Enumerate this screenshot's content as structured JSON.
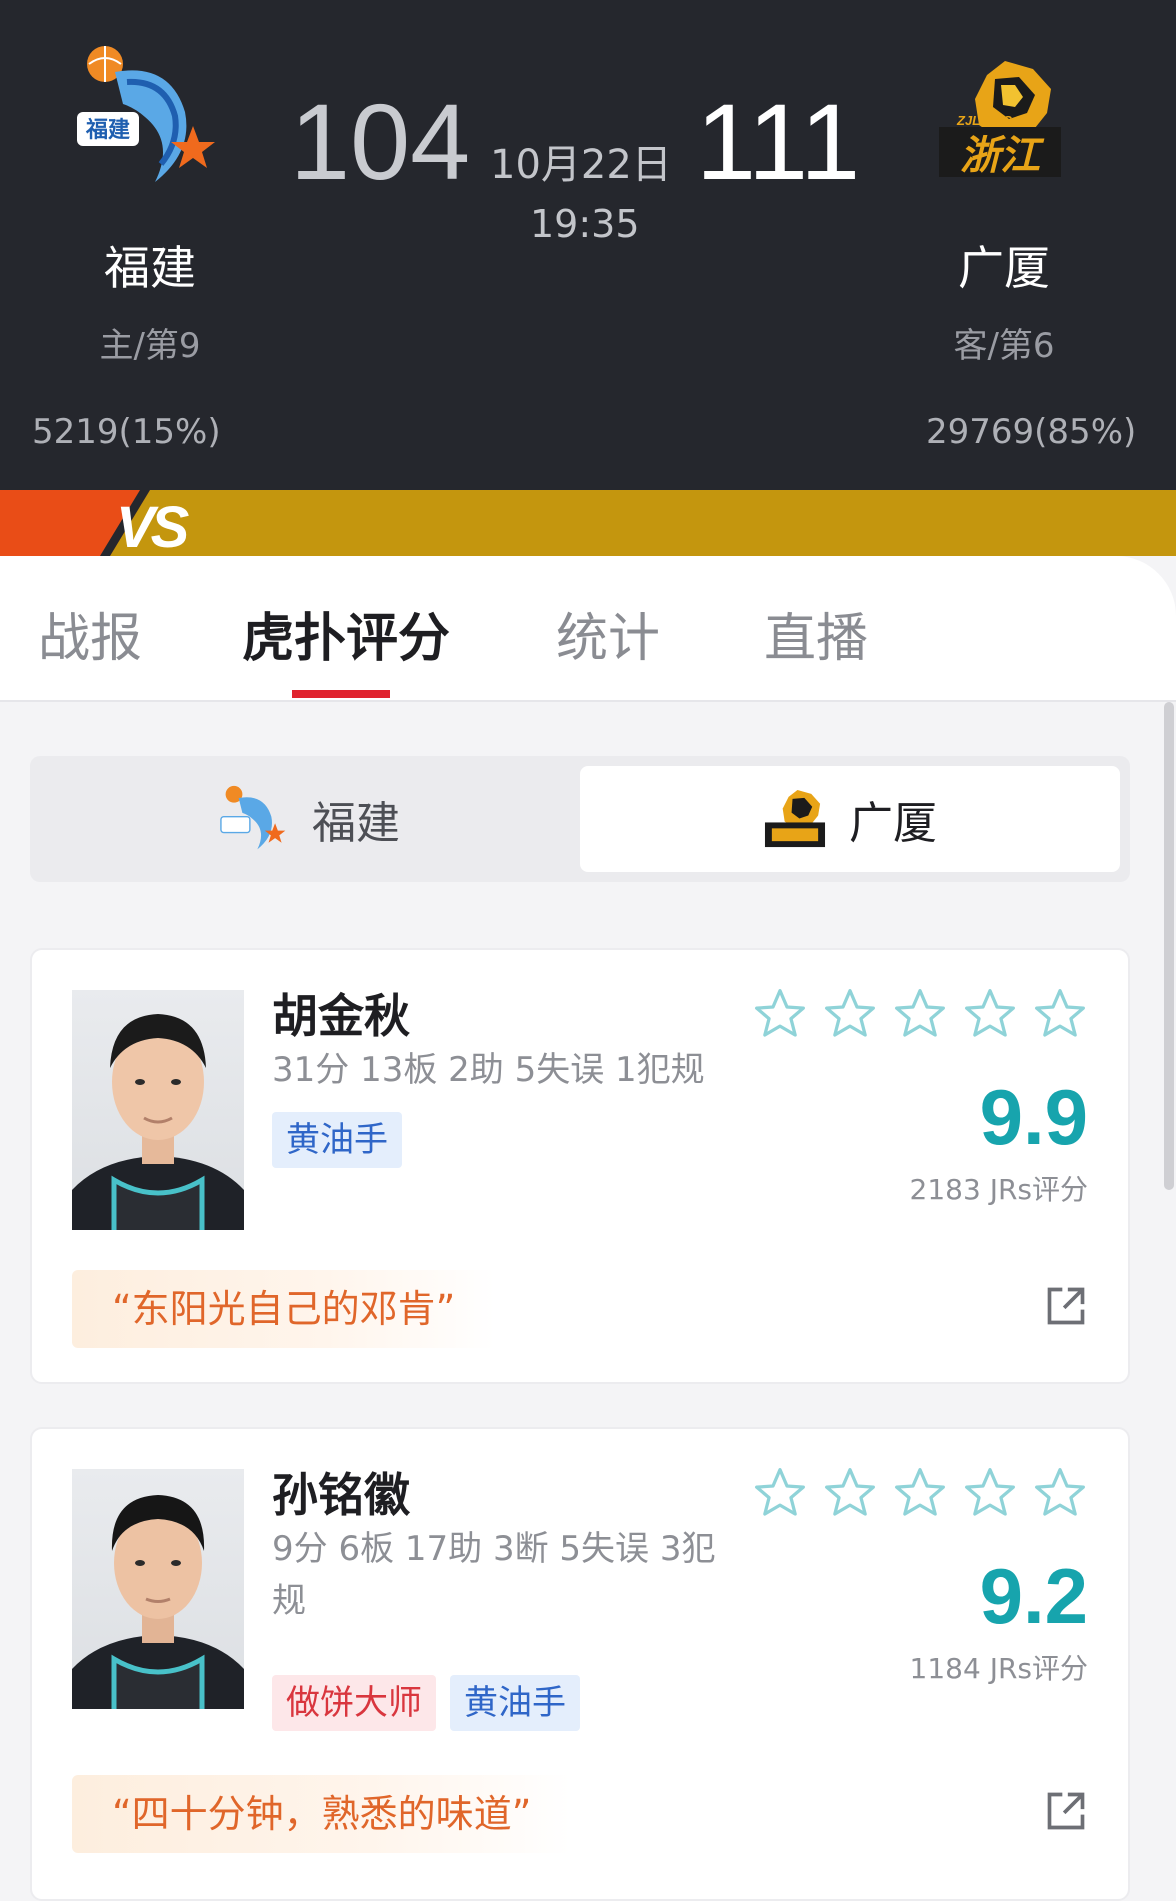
{
  "game": {
    "date": "10月22日",
    "time": "19:35",
    "vs_label": "VS",
    "home": {
      "name": "福建",
      "logo_text": "福建",
      "rank": "主/第9",
      "score": "104",
      "support": "5219(15%)",
      "color": "#e94d17",
      "logo_icon": "fujian-shark-icon"
    },
    "away": {
      "name": "广厦",
      "logo_text": "浙江",
      "logo_subtext": "ZJLIONS",
      "rank": "客/第6",
      "score": "111",
      "support": "29769(85%)",
      "color": "#c4960e",
      "logo_icon": "zhejiang-lion-icon"
    }
  },
  "tabs": [
    {
      "label": "战报",
      "active": false
    },
    {
      "label": "虎扑评分",
      "active": true
    },
    {
      "label": "统计",
      "active": false
    },
    {
      "label": "直播",
      "active": false
    }
  ],
  "team_switch": {
    "left": "福建",
    "right": "广厦",
    "selected": "广厦"
  },
  "players": [
    {
      "name": "胡金秋",
      "stats": "31分 13板 2助 5失误 1犯规",
      "tags": [
        {
          "label": "黄油手",
          "type": "blue"
        }
      ],
      "stars": 0,
      "rating": "9.9",
      "votes": "2183 JRs评分",
      "quote": "“东阳光自己的邓肯”"
    },
    {
      "name": "孙铭徽",
      "stats": "9分 6板 17助 3断 5失误 3犯规",
      "tags": [
        {
          "label": "做饼大师",
          "type": "red"
        },
        {
          "label": "黄油手",
          "type": "blue"
        }
      ],
      "stars": 0,
      "rating": "9.2",
      "votes": "1184 JRs评分",
      "quote": "“四十分钟，熟悉的味道”"
    }
  ],
  "colors": {
    "header_bg": "#25272d",
    "accent_red": "#e0232e",
    "rating_teal": "#17a4ad",
    "star_outline": "#8fd3d8"
  }
}
